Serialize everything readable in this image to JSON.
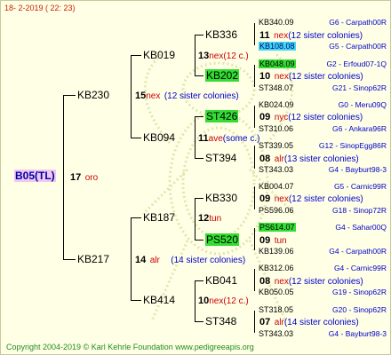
{
  "header": {
    "date": "18-  2-2019 ( 22: 23)"
  },
  "footer": {
    "copyright": "Copyright 2004-2019 © Karl Kehrle Foundation     www.pedigreeapis.org"
  },
  "root": {
    "name": "B05(TL)",
    "year": "17",
    "breeder": "oro"
  },
  "level1": [
    {
      "name": "KB230",
      "year": "15",
      "breeder": "nex",
      "note": "(12 sister colonies)"
    },
    {
      "name": "KB217",
      "year": "14",
      "breeder": "alr",
      "note": "(14 sister colonies)"
    }
  ],
  "level2": [
    {
      "name": "KB019",
      "year": "13",
      "breeder": "nex",
      "note": "(12 c.)"
    },
    {
      "name": "KB094",
      "year": "11",
      "breeder": "ave",
      "note": "(some c.)"
    },
    {
      "name": "KB187",
      "year": "12",
      "breeder": "tun",
      "note": ""
    },
    {
      "name": "KB414",
      "year": "10",
      "breeder": "nex",
      "note": "(12 c.)"
    }
  ],
  "level3": [
    {
      "name": "KB336",
      "year": "11",
      "breeder": "nex",
      "note": "(12 sister colonies)",
      "highlight": "none"
    },
    {
      "name": "KB202",
      "year": "10",
      "breeder": "nex",
      "note": "(12 sister colonies)",
      "highlight": "green"
    },
    {
      "name": "ST426",
      "year": "09",
      "breeder": "nyc",
      "note": "(12 sister colonies)",
      "highlight": "green"
    },
    {
      "name": "ST394",
      "year": "08",
      "breeder": "alr",
      "note": "(13 sister colonies)",
      "highlight": "none"
    },
    {
      "name": "KB330",
      "year": "09",
      "breeder": "nex",
      "note": "(12 sister colonies)",
      "highlight": "none"
    },
    {
      "name": "PS520",
      "year": "09",
      "breeder": "tun",
      "note": "",
      "highlight": "green"
    },
    {
      "name": "KB041",
      "year": "08",
      "breeder": "nex",
      "note": "(12 sister colonies)",
      "highlight": "none"
    },
    {
      "name": "ST348",
      "year": "07",
      "breeder": "alr",
      "note": "(14 sister colonies)",
      "highlight": "none"
    }
  ],
  "level4": [
    {
      "name": "KB340.09",
      "source": "G6 - Carpath00R",
      "highlight": "none"
    },
    {
      "name": "KB108.08",
      "source": "G5 - Carpath00R",
      "highlight": "cyan"
    },
    {
      "name": "KB048.09",
      "source": "G2 - Erfoud07-1Q",
      "highlight": "green"
    },
    {
      "name": "ST348.07",
      "source": "G21 - Sinop62R",
      "highlight": "none"
    },
    {
      "name": "KB024.09",
      "source": "G0 - Meru09Q",
      "highlight": "none"
    },
    {
      "name": "ST310.06",
      "source": "G6 - Ankara96R",
      "highlight": "none"
    },
    {
      "name": "ST339.05",
      "source": "G12 - SinopEgg86R",
      "highlight": "none"
    },
    {
      "name": "ST343.03",
      "source": "G4 - Bayburt98-3",
      "highlight": "none"
    },
    {
      "name": "KB004.07",
      "source": "G5 - Carnic99R",
      "highlight": "none"
    },
    {
      "name": "PS596.06",
      "source": "G18 - Sinop72R",
      "highlight": "none"
    },
    {
      "name": "PS614.07",
      "source": "G4 - Sahar00Q",
      "highlight": "green"
    },
    {
      "name": "KB139.06",
      "source": "G4 - Carpath00R",
      "highlight": "none"
    },
    {
      "name": "KB312.06",
      "source": "G4 - Carnic99R",
      "highlight": "none"
    },
    {
      "name": "KB050.05",
      "source": "G19 - Sinop62R",
      "highlight": "none"
    },
    {
      "name": "ST318.05",
      "source": "G20 - Sinop62R",
      "highlight": "none"
    },
    {
      "name": "ST343.03",
      "source": "G4 - Bayburt98-3",
      "highlight": "none"
    }
  ]
}
